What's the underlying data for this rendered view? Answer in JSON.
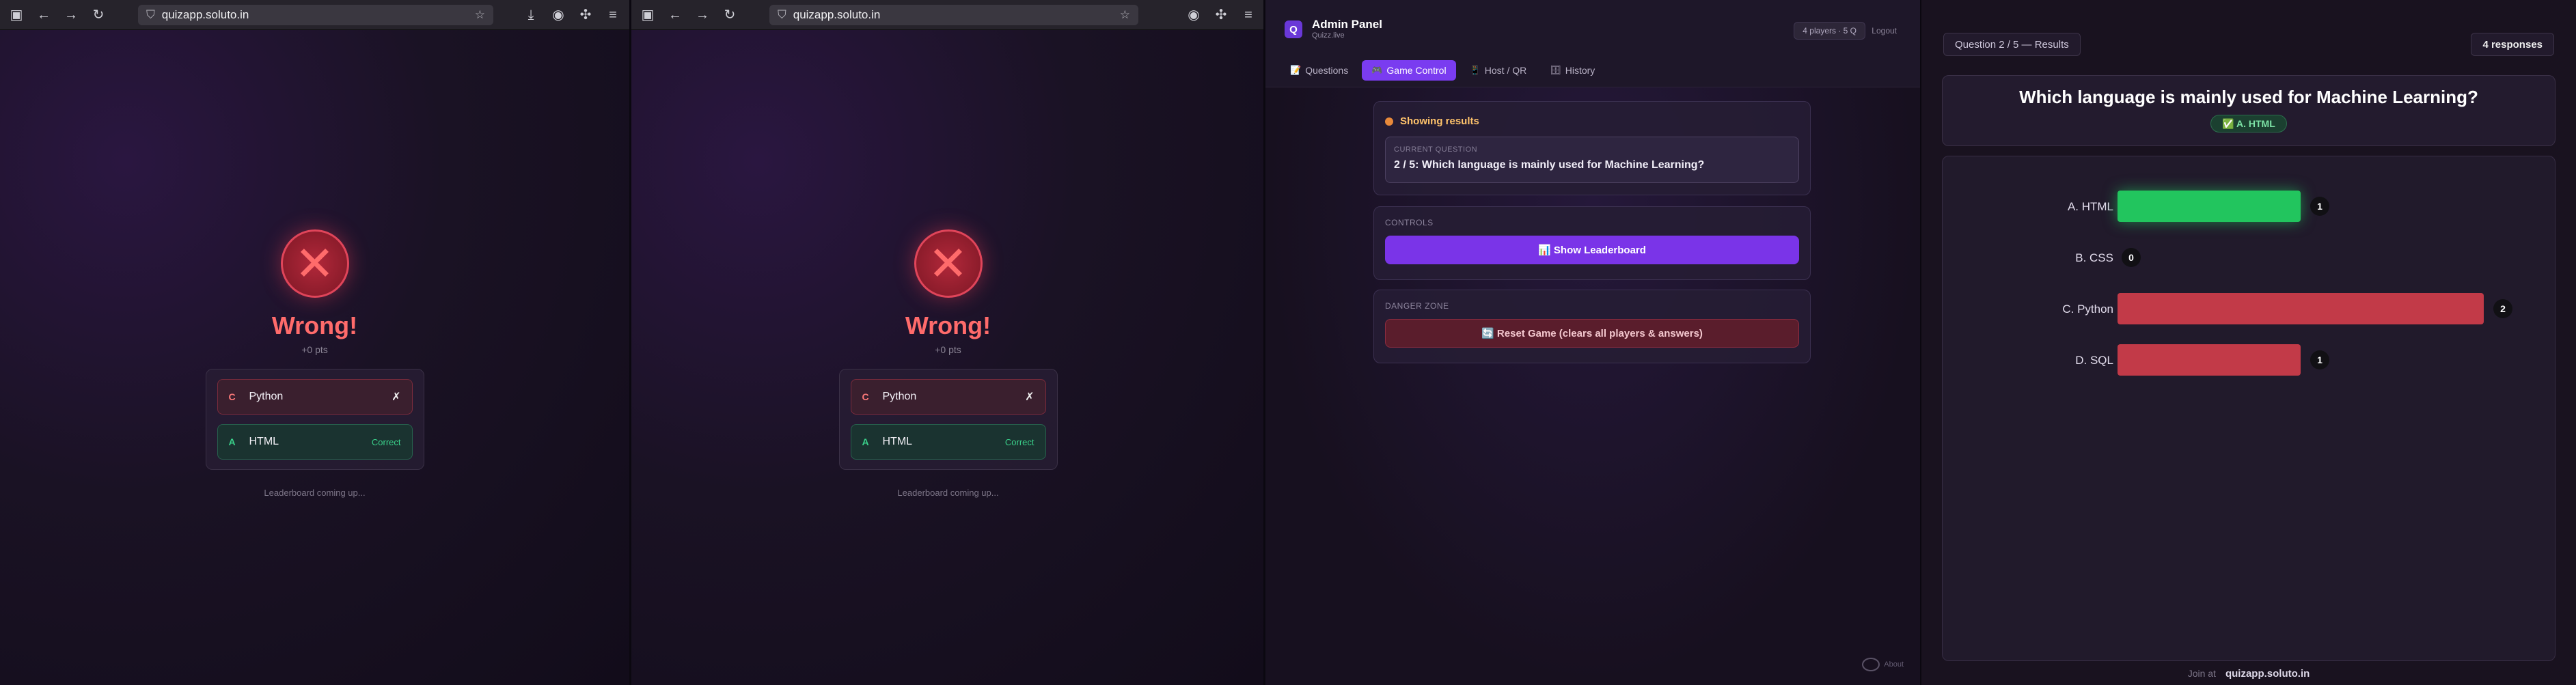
{
  "browser": {
    "url_host": "quizapp.soluto.in",
    "url_prefix": "quizapp."
  },
  "player": {
    "result_title": "Wrong!",
    "points": "+0 pts",
    "answers": [
      {
        "letter": "C",
        "text": "Python",
        "mark": "✗"
      },
      {
        "letter": "A",
        "text": "HTML",
        "mark": "Correct"
      }
    ],
    "footer": "Leaderboard coming up..."
  },
  "admin": {
    "title": "Admin Panel",
    "subtitle": "Quizz.live",
    "players_badge": "4 players · 5 Q",
    "logout": "Logout",
    "tabs": [
      {
        "icon": "📝",
        "label": "Questions"
      },
      {
        "icon": "🎮",
        "label": "Game Control"
      },
      {
        "icon": "📱",
        "label": "Host / QR"
      },
      {
        "icon": "🗄",
        "label": "History"
      }
    ],
    "status": "Showing results",
    "current_question_label": "CURRENT QUESTION",
    "current_question": "2 / 5: Which language is mainly used for Machine Learning?",
    "controls_label": "CONTROLS",
    "leaderboard_button": "📊 Show Leaderboard",
    "danger_label": "DANGER ZONE",
    "reset_button": "🔄 Reset Game (clears all players & answers)",
    "about": "About"
  },
  "board": {
    "question_pill": "Question 2 / 5 — Results",
    "responses": "4 responses",
    "question": "Which language is mainly used for Machine Learning?",
    "correct": "✅ A. HTML",
    "join_label": "Join at",
    "join_url": "quizapp.soluto.in"
  },
  "chart_data": {
    "type": "bar",
    "orientation": "horizontal",
    "categories": [
      "A. HTML",
      "B. CSS",
      "C. Python",
      "D. SQL"
    ],
    "values": [
      1,
      0,
      2,
      1
    ],
    "xlim": [
      0,
      2
    ],
    "correct_index": 0,
    "colors": {
      "correct": "#22c55e",
      "wrong": "#c23a48"
    }
  }
}
